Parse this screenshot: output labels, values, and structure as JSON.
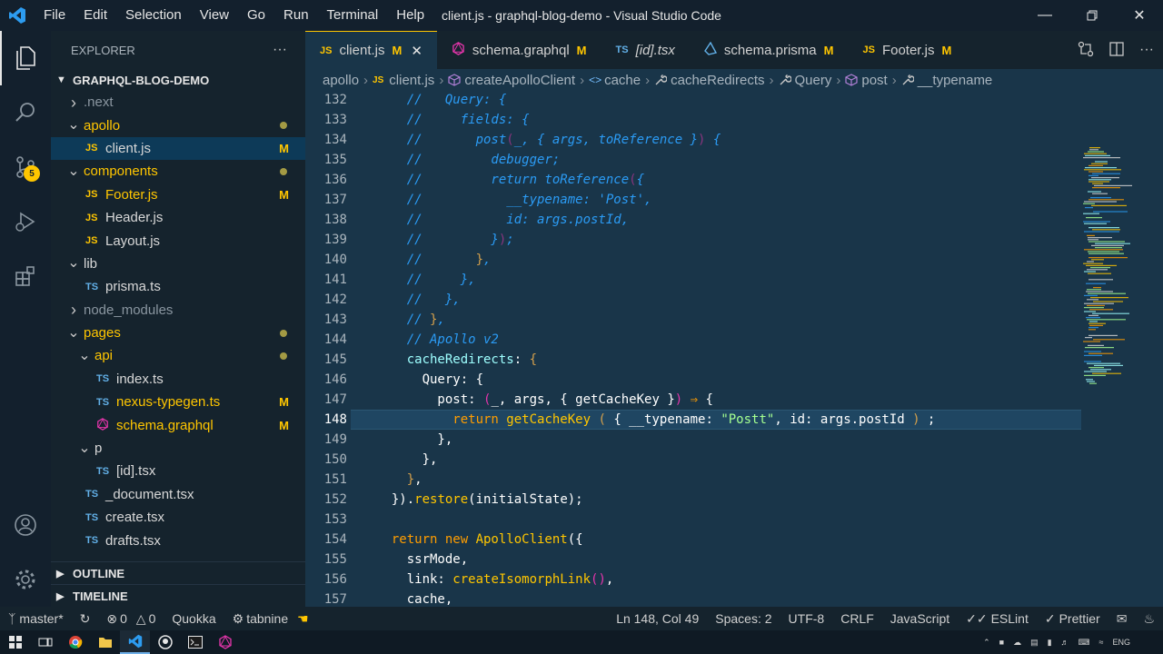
{
  "window": {
    "title": "client.js - graphql-blog-demo - Visual Studio Code",
    "menu": [
      "File",
      "Edit",
      "Selection",
      "View",
      "Go",
      "Run",
      "Terminal",
      "Help"
    ]
  },
  "activity": {
    "scm_badge": "5"
  },
  "sidebar": {
    "header": "EXPLORER",
    "more": "···",
    "project": "GRAPHQL-BLOG-DEMO",
    "items": [
      {
        "label": "next",
        "prefix": ".",
        "kind": "folder-collapsed",
        "depth": 1,
        "dim": true
      },
      {
        "label": "apollo",
        "kind": "folder-open",
        "depth": 1,
        "dot": true,
        "modified": true
      },
      {
        "label": "client.js",
        "kind": "js",
        "depth": 2,
        "mark": "M",
        "selected": true
      },
      {
        "label": "components",
        "kind": "folder-open",
        "depth": 1,
        "dot": true,
        "modified": true
      },
      {
        "label": "Footer.js",
        "kind": "js",
        "depth": 2,
        "mark": "M",
        "modified": true
      },
      {
        "label": "Header.js",
        "kind": "js",
        "depth": 2
      },
      {
        "label": "Layout.js",
        "kind": "js",
        "depth": 2
      },
      {
        "label": "lib",
        "kind": "folder-open",
        "depth": 1
      },
      {
        "label": "prisma.ts",
        "kind": "ts",
        "depth": 2
      },
      {
        "label": "node_modules",
        "kind": "folder-collapsed",
        "depth": 1,
        "dim": true
      },
      {
        "label": "pages",
        "kind": "folder-open",
        "depth": 1,
        "dot": true,
        "modified": true
      },
      {
        "label": "api",
        "kind": "folder-open",
        "depth": 2,
        "dot": true,
        "modified": true
      },
      {
        "label": "index.ts",
        "kind": "ts",
        "depth": 3
      },
      {
        "label": "nexus-typegen.ts",
        "kind": "ts",
        "depth": 3,
        "mark": "M",
        "modified": true
      },
      {
        "label": "schema.graphql",
        "kind": "gql",
        "depth": 3,
        "mark": "M",
        "modified": true
      },
      {
        "label": "p",
        "kind": "folder-open",
        "depth": 2
      },
      {
        "label": "[id].tsx",
        "kind": "ts",
        "depth": 3
      },
      {
        "label": "_document.tsx",
        "kind": "ts",
        "depth": 2
      },
      {
        "label": "create.tsx",
        "kind": "ts",
        "depth": 2
      },
      {
        "label": "drafts.tsx",
        "kind": "ts",
        "depth": 2
      }
    ],
    "outline": "OUTLINE",
    "timeline": "TIMELINE"
  },
  "tabs": [
    {
      "label": "client.js",
      "icon": "JS",
      "kind": "js",
      "mark": "M",
      "active": true
    },
    {
      "label": "schema.graphql",
      "icon": "gql",
      "kind": "gql",
      "mark": "M"
    },
    {
      "label": "[id].tsx",
      "icon": "TS",
      "kind": "ts",
      "italic": true
    },
    {
      "label": "schema.prisma",
      "icon": "prisma",
      "kind": "prisma",
      "mark": "M"
    },
    {
      "label": "Footer.js",
      "icon": "JS",
      "kind": "js",
      "mark": "M"
    }
  ],
  "breadcrumbs": [
    "apollo",
    "client.js",
    "createApolloClient",
    "cache",
    "cacheRedirects",
    "Query",
    "post",
    "__typename"
  ],
  "code": {
    "current_line": 148,
    "lines": [
      {
        "n": 132,
        "t": [
          [
            "c",
            "    //   Query: {"
          ]
        ]
      },
      {
        "n": 133,
        "t": [
          [
            "c",
            "    //     fields: {"
          ]
        ]
      },
      {
        "n": 134,
        "t": [
          [
            "c",
            "    //       post"
          ],
          [
            "b1",
            "("
          ],
          [
            "c",
            "_, { args, toReference }"
          ],
          [
            "b1",
            ")"
          ],
          [
            "c",
            " {"
          ]
        ]
      },
      {
        "n": 135,
        "t": [
          [
            "c",
            "    //         debugger;"
          ]
        ]
      },
      {
        "n": 136,
        "t": [
          [
            "c",
            "    //         return toReference"
          ],
          [
            "b1",
            "("
          ],
          [
            "c",
            "{"
          ]
        ]
      },
      {
        "n": 137,
        "t": [
          [
            "c",
            "    //           __typename: 'Post',"
          ]
        ]
      },
      {
        "n": 138,
        "t": [
          [
            "c",
            "    //           id: args.postId,"
          ]
        ]
      },
      {
        "n": 139,
        "t": [
          [
            "c",
            "    //         }"
          ],
          [
            "b1",
            ")"
          ],
          [
            "c",
            ";"
          ]
        ]
      },
      {
        "n": 140,
        "t": [
          [
            "c",
            "    //       "
          ],
          [
            "b2",
            "}"
          ],
          [
            "c",
            ","
          ]
        ]
      },
      {
        "n": 141,
        "t": [
          [
            "c",
            "    //     },"
          ]
        ]
      },
      {
        "n": 142,
        "t": [
          [
            "c",
            "    //   },"
          ]
        ]
      },
      {
        "n": 143,
        "t": [
          [
            "c",
            "    // "
          ],
          [
            "b2",
            "}"
          ],
          [
            "c",
            ","
          ]
        ]
      },
      {
        "n": 144,
        "t": [
          [
            "c",
            "    // Apollo v2"
          ]
        ]
      },
      {
        "n": 145,
        "t": [
          [
            "p",
            "    cacheRedirects"
          ],
          [
            "w",
            ": "
          ],
          [
            "b2",
            "{"
          ]
        ]
      },
      {
        "n": 146,
        "t": [
          [
            "w",
            "      Query: {"
          ]
        ]
      },
      {
        "n": 147,
        "t": [
          [
            "w",
            "        post: "
          ],
          [
            "b1",
            "("
          ],
          [
            "w",
            "_, args, { getCacheKey }"
          ],
          [
            "b1",
            ")"
          ],
          [
            "w",
            " "
          ],
          [
            "k",
            "⇒"
          ],
          [
            "w",
            " {"
          ]
        ]
      },
      {
        "n": 148,
        "t": [
          [
            "k",
            "          return "
          ],
          [
            "f",
            "getCacheKey"
          ],
          [
            "w",
            " "
          ],
          [
            "b2",
            "("
          ],
          [
            "w",
            " { __typename: "
          ],
          [
            "s",
            "\"Postt\""
          ],
          [
            "w",
            ", id: args.postId "
          ],
          [
            "b2",
            ")"
          ],
          [
            "w",
            " ;"
          ]
        ]
      },
      {
        "n": 149,
        "t": [
          [
            "w",
            "        },"
          ]
        ]
      },
      {
        "n": 150,
        "t": [
          [
            "w",
            "      },"
          ]
        ]
      },
      {
        "n": 151,
        "t": [
          [
            "w",
            "    "
          ],
          [
            "b2",
            "}"
          ],
          [
            "w",
            ","
          ]
        ]
      },
      {
        "n": 152,
        "t": [
          [
            "w",
            "  })."
          ],
          [
            "f",
            "restore"
          ],
          [
            "w",
            "(initialState);"
          ]
        ]
      },
      {
        "n": 153,
        "t": [
          [
            "w",
            ""
          ]
        ]
      },
      {
        "n": 154,
        "t": [
          [
            "k",
            "  return new "
          ],
          [
            "f",
            "ApolloClient"
          ],
          [
            "w",
            "({"
          ]
        ]
      },
      {
        "n": 155,
        "t": [
          [
            "w",
            "    ssrMode,"
          ]
        ]
      },
      {
        "n": 156,
        "t": [
          [
            "w",
            "    link: "
          ],
          [
            "f",
            "createIsomorphLink"
          ],
          [
            "b1",
            "()"
          ],
          [
            "w",
            ","
          ]
        ]
      },
      {
        "n": 157,
        "t": [
          [
            "w",
            "    cache,"
          ]
        ]
      }
    ]
  },
  "status": {
    "branch": "master*",
    "errors": "0",
    "warnings": "0",
    "quokka": "Quokka",
    "tabnine": "tabnine",
    "position": "Ln 148, Col 49",
    "spaces": "Spaces: 2",
    "encoding": "UTF-8",
    "eol": "CRLF",
    "language": "JavaScript",
    "eslint": "ESLint",
    "prettier": "Prettier"
  },
  "taskbar": {
    "lang": "ENG"
  },
  "colors": {
    "comment": "#2b9bf4",
    "keyword": "#ff9d00",
    "function": "#ffc600",
    "string": "#a5ff90",
    "property": "#9effff",
    "text": "#ffffff",
    "bracket1": "#e535ab",
    "bracket2": "#d4a04c"
  }
}
